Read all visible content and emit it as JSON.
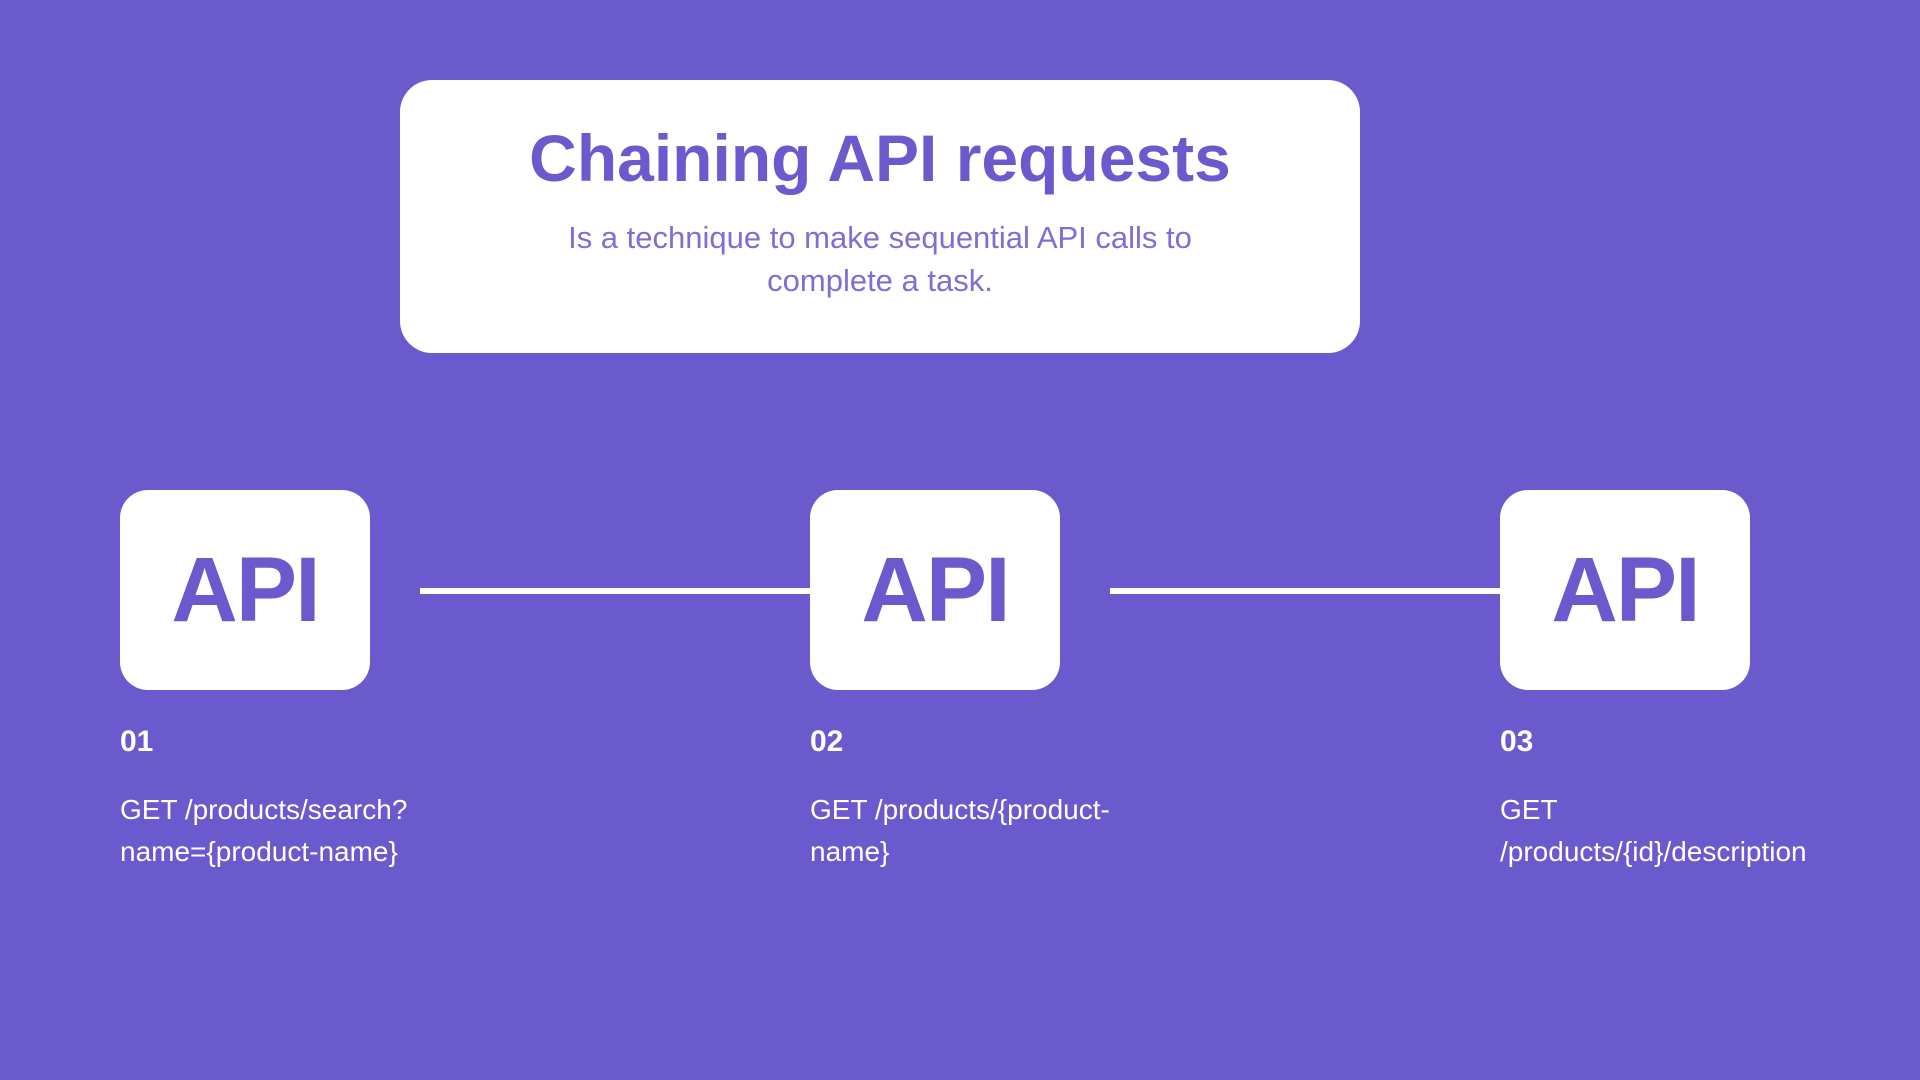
{
  "header": {
    "title": "Chaining API requests",
    "subtitle": "Is a technique to make sequential API calls to complete a task."
  },
  "steps": [
    {
      "api_label": "API",
      "number": "01",
      "endpoint": "GET /products/search?name={product-name}"
    },
    {
      "api_label": "API",
      "number": "02",
      "endpoint": "GET /products/{product-name}"
    },
    {
      "api_label": "API",
      "number": "03",
      "endpoint": "GET /products/{id}/description"
    }
  ]
}
